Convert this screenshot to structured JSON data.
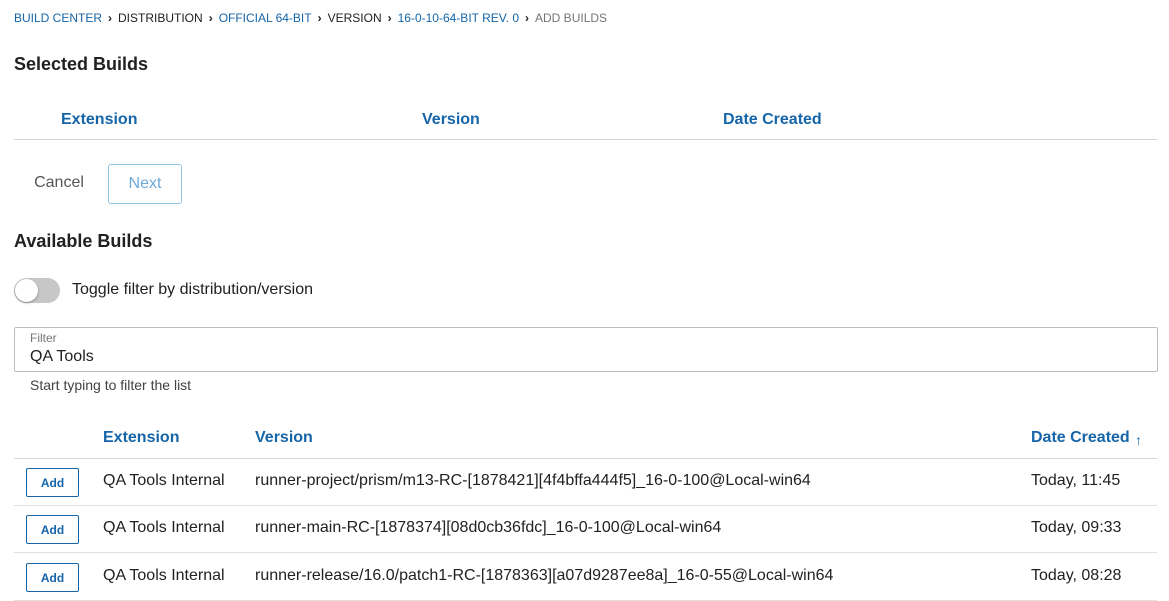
{
  "breadcrumb": [
    {
      "label": "BUILD CENTER",
      "style": "link"
    },
    {
      "label": "DISTRIBUTION",
      "style": "plain"
    },
    {
      "label": "OFFICIAL 64-BIT",
      "style": "link"
    },
    {
      "label": "VERSION",
      "style": "plain"
    },
    {
      "label": "16-0-10-64-BIT REV. 0",
      "style": "link"
    },
    {
      "label": "ADD BUILDS",
      "style": "current"
    }
  ],
  "selected": {
    "title": "Selected Builds",
    "columns": {
      "extension": "Extension",
      "version": "Version",
      "date": "Date Created"
    }
  },
  "actions": {
    "cancel_label": "Cancel",
    "next_label": "Next"
  },
  "available": {
    "title": "Available Builds",
    "toggle_label": "Toggle filter by distribution/version",
    "toggle_on": false,
    "filter": {
      "label": "Filter",
      "value": "QA Tools",
      "helper": "Start typing to filter the list"
    },
    "columns": {
      "extension": "Extension",
      "version": "Version",
      "date": "Date Created",
      "sort_icon": "arrow-up-icon"
    },
    "add_label": "Add",
    "rows": [
      {
        "extension": "QA Tools Internal",
        "version": "runner-project/prism/m13-RC-[1878421][4f4bffa444f5]_16-0-100@Local-win64",
        "date": "Today, 11:45"
      },
      {
        "extension": "QA Tools Internal",
        "version": "runner-main-RC-[1878374][08d0cb36fdc]_16-0-100@Local-win64",
        "date": "Today, 09:33"
      },
      {
        "extension": "QA Tools Internal",
        "version": "runner-release/16.0/patch1-RC-[1878363][a07d9287ee8a]_16-0-55@Local-win64",
        "date": "Today, 08:28"
      }
    ]
  },
  "colors": {
    "accent": "#1565a8",
    "next_border": "#90c2e6",
    "toggle_off": "#c7c7c7"
  }
}
